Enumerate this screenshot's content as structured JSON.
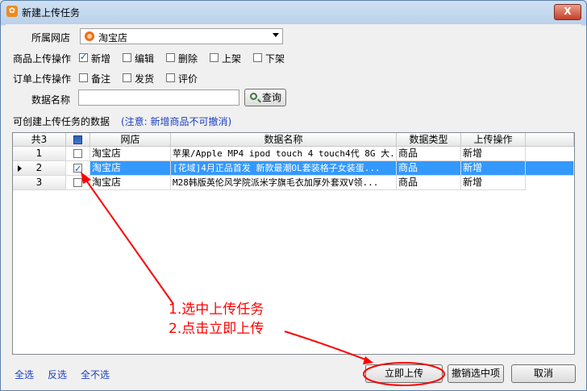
{
  "window": {
    "title": "新建上传任务",
    "close_label": "X",
    "icon_name": "app-icon"
  },
  "form": {
    "shop_label": "所属网店",
    "shop_value": "淘宝店",
    "product_ops_label": "商品上传操作",
    "product_ops": [
      {
        "label": "新增",
        "checked": true
      },
      {
        "label": "编辑",
        "checked": false
      },
      {
        "label": "删除",
        "checked": false
      },
      {
        "label": "上架",
        "checked": false
      },
      {
        "label": "下架",
        "checked": false
      }
    ],
    "order_ops_label": "订单上传操作",
    "order_ops": [
      {
        "label": "备注",
        "checked": false
      },
      {
        "label": "发货",
        "checked": false
      },
      {
        "label": "评价",
        "checked": false
      }
    ],
    "data_name_label": "数据名称",
    "data_name_value": "",
    "query_label": "查询"
  },
  "list_caption": "可创建上传任务的数据",
  "note": "(注意: 新增商品不可撤消)",
  "table": {
    "count_header": "共3",
    "columns": [
      "网店",
      "数据名称",
      "数据类型",
      "上传操作"
    ],
    "rows": [
      {
        "num": "1",
        "checked": false,
        "shop": "淘宝店",
        "name": "苹果/Apple MP4 ipod touch 4 touch4代 8G 大...",
        "type": "商品",
        "op": "新增",
        "selected": false
      },
      {
        "num": "2",
        "checked": true,
        "shop": "淘宝店",
        "name": "[花域]4月正品首发 新款最潮OL套装格子女装蛋...",
        "type": "商品",
        "op": "新增",
        "selected": true
      },
      {
        "num": "3",
        "checked": false,
        "shop": "淘宝店",
        "name": "M28韩版英伦风学院派米字旗毛衣加厚外套双V领...",
        "type": "商品",
        "op": "新增",
        "selected": false
      }
    ]
  },
  "links": {
    "select_all": "全选",
    "invert": "反选",
    "select_none": "全不选"
  },
  "buttons": {
    "upload_now": "立即上传",
    "undo_selected": "撤销选中项",
    "cancel": "取消"
  },
  "annotation": {
    "line1": "1.选中上传任务",
    "line2": "2.点击立即上传",
    "color": "#ff0000"
  }
}
